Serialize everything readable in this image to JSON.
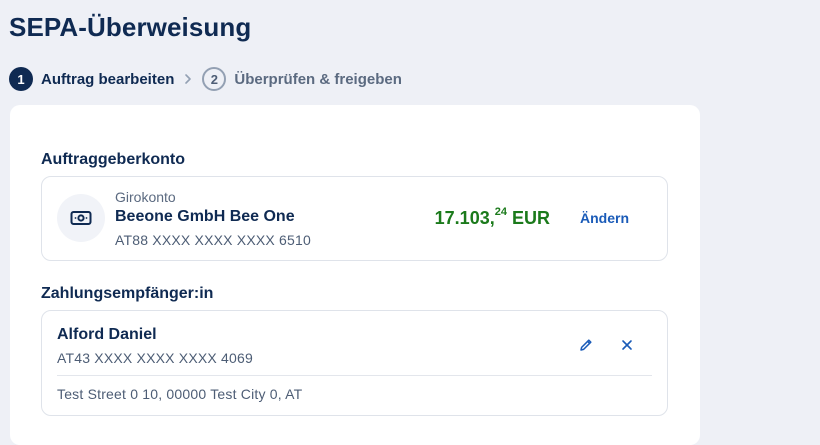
{
  "page": {
    "title": "SEPA-Überweisung"
  },
  "stepper": {
    "steps": [
      {
        "number": "1",
        "label": "Auftrag bearbeiten",
        "state": "active"
      },
      {
        "number": "2",
        "label": "Überprüfen & freigeben",
        "state": "inactive"
      }
    ]
  },
  "sender": {
    "section_label": "Auftraggeberkonto",
    "account_type": "Girokonto",
    "account_name": "Beeone GmbH Bee One",
    "iban": "AT88 XXXX XXXX XXXX 6510",
    "balance_main": "17.103,",
    "balance_cents": "24",
    "currency": "EUR",
    "change_label": "Ändern",
    "icon": "cash-icon"
  },
  "recipient": {
    "section_label": "Zahlungsempfänger:in",
    "name": "Alford Daniel",
    "iban": "AT43 XXXX XXXX XXXX 4069",
    "address": "Test Street 0 10, 00000 Test City 0, AT",
    "edit_icon": "pencil-icon",
    "remove_icon": "close-icon"
  },
  "colors": {
    "primary": "#0f2a52",
    "link": "#1a5bb8",
    "balance": "#1b7a1b",
    "background": "#eef0f6"
  }
}
